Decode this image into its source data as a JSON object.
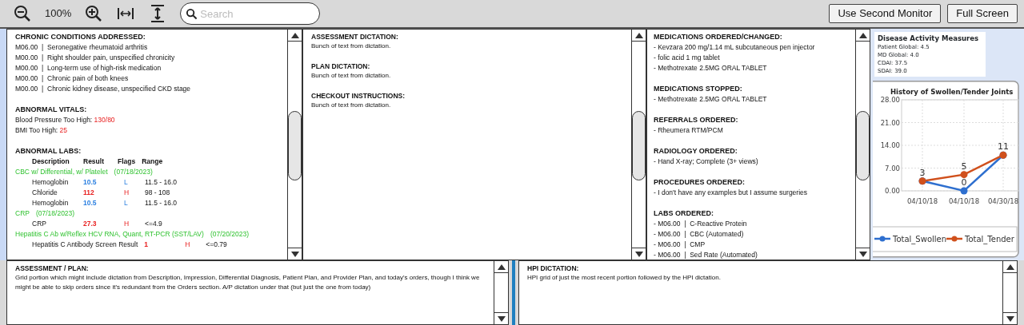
{
  "toolbar": {
    "zoom_label": "100%",
    "search": {
      "placeholder": "Search"
    },
    "buttons": [
      "Use Second Monitor",
      "Full Screen"
    ]
  },
  "summary_panel": {
    "sections": [
      {
        "kind": "list",
        "heading": "CHRONIC CONDITIONS ADDRESSED:",
        "items": [
          "M06.00  |  Seronegative rheumatoid arthritis",
          "M00.00  |  Right shoulder pain, unspecified chronicity",
          "M00.00  |  Long-term use of high-risk medication",
          "M00.00  |  Chronic pain of both knees",
          "M00.00  |  Chronic kidney disease, unspecified CKD stage"
        ]
      },
      {
        "kind": "vitals",
        "heading": "ABNORMAL VITALS:",
        "items": [
          {
            "label": "Blood Pressure Too High:",
            "value": "130/80"
          },
          {
            "label": "BMI Too High:",
            "value": "25"
          }
        ]
      },
      {
        "kind": "labs",
        "heading": "ABNORMAL LABS:",
        "columns": [
          "Description",
          "Result",
          "Flags",
          "Range"
        ],
        "groups": [
          {
            "name": "CBC w/ Differential, w/ Platelet",
            "date": "(07/18/2023)",
            "results": [
              {
                "description": "Hemoglobin",
                "result": "10.5",
                "flag": "L",
                "color": "#2a7fe0",
                "range": "11.5 - 16.0"
              },
              {
                "description": "Chloride",
                "result": "112",
                "flag": "H",
                "color": "#e82020",
                "range": "98 - 108"
              },
              {
                "description": "Hemoglobin",
                "result": "10.5",
                "flag": "L",
                "color": "#2a7fe0",
                "range": "11.5 - 16.0"
              }
            ]
          },
          {
            "name": "CRP",
            "date": "(07/18/2023)",
            "results": [
              {
                "description": "CRP",
                "result": "27.3",
                "flag": "H",
                "color": "#e82020",
                "range": "<=4.9"
              }
            ]
          },
          {
            "name": "Hepatitis C Ab w/Reflex HCV RNA, Quant, RT-PCR (SST/LAV)",
            "date": "(07/20/2023)",
            "results": [
              {
                "description": "Hepatitis C Antibody Screen Result",
                "result": "1",
                "flag": "H",
                "color": "#e82020",
                "range": "<=0.79"
              }
            ]
          }
        ]
      }
    ]
  },
  "dictation_panel": {
    "sections": [
      {
        "heading": "ASSESSMENT DICTATION:",
        "text": "Bunch of text from dictation."
      },
      {
        "heading": "PLAN DICTATION:",
        "text": "Bunch of text from dictation."
      },
      {
        "heading": "CHECKOUT INSTRUCTIONS:",
        "text": "Bunch of text from dictation."
      }
    ]
  },
  "orders_panel": {
    "sections": [
      {
        "heading": "MEDICATIONS ORDERED/CHANGED:",
        "items": [
          "- Kevzara 200 mg/1.14 mL subcutaneous pen injector",
          "- folic acid 1 mg tablet",
          "- Methotrexate 2.5MG ORAL TABLET"
        ]
      },
      {
        "heading": "MEDICATIONS STOPPED:",
        "items": [
          "- Methotrexate 2.5MG ORAL TABLET"
        ]
      },
      {
        "heading": "REFERRALS ORDERED:",
        "items": [
          "- Rheumera RTM/PCM"
        ]
      },
      {
        "heading": "RADIOLOGY ORDERED:",
        "items": [
          "- Hand X-ray; Complete (3+ views)"
        ]
      },
      {
        "heading": "PROCEDURES ORDERED:",
        "items": [
          "- I don't have any examples but I assume surgeries"
        ]
      },
      {
        "heading": "LABS ORDERED:",
        "items": [
          "- M06.00  |  C-Reactive Protein",
          "- M06.00  |  CBC (Automated)",
          "- M06.00  |  CMP",
          "- M06.00  |  Sed Rate (Automated)"
        ]
      }
    ]
  },
  "disease_activity": {
    "title": "Disease Activity Measures",
    "lines": [
      "Patient Global: 4.5",
      "MD Global: 4.0",
      "CDAI: 37.5",
      "SDAI: 39.0"
    ]
  },
  "joints_chart": {
    "chart_data": {
      "type": "line",
      "title": "History of Swollen/Tender Joints",
      "categories": [
        "04/10/18",
        "04/10/18",
        "04/30/18"
      ],
      "series": [
        {
          "name": "Total_Swollen",
          "color": "#2e6fcf",
          "marker": "circle",
          "values": [
            3,
            0,
            11
          ],
          "value_labels": [
            "3",
            "0",
            "11"
          ]
        },
        {
          "name": "Total_Tender",
          "color": "#d0501c",
          "marker": "circle",
          "values": [
            3,
            5,
            11
          ],
          "value_labels": [
            null,
            "5",
            null
          ]
        }
      ],
      "ylim": [
        0,
        28
      ],
      "yticks": [
        {
          "value": 0,
          "label": "0.00"
        },
        {
          "value": 7,
          "label": "7.00"
        },
        {
          "value": 14,
          "label": "14.00"
        },
        {
          "value": 21,
          "label": "21.00"
        },
        {
          "value": 28,
          "label": "28.00"
        }
      ],
      "grid": true,
      "legend": true
    }
  },
  "assessment_plan": {
    "heading": "ASSESSMENT / PLAN:",
    "text": "Grid portion which might include dictation from Description, Impression, Differential Diagnosis, Patient Plan, and Provider Plan, and today's orders, though I think we might be able to skip orders since it's redundant from the Orders section. A/P dictation under that (but just the one from today)"
  },
  "hpi": {
    "heading": "HPI DICTATION:",
    "text": "HPI grid of just the most recent portion followed by the HPI dictation."
  }
}
